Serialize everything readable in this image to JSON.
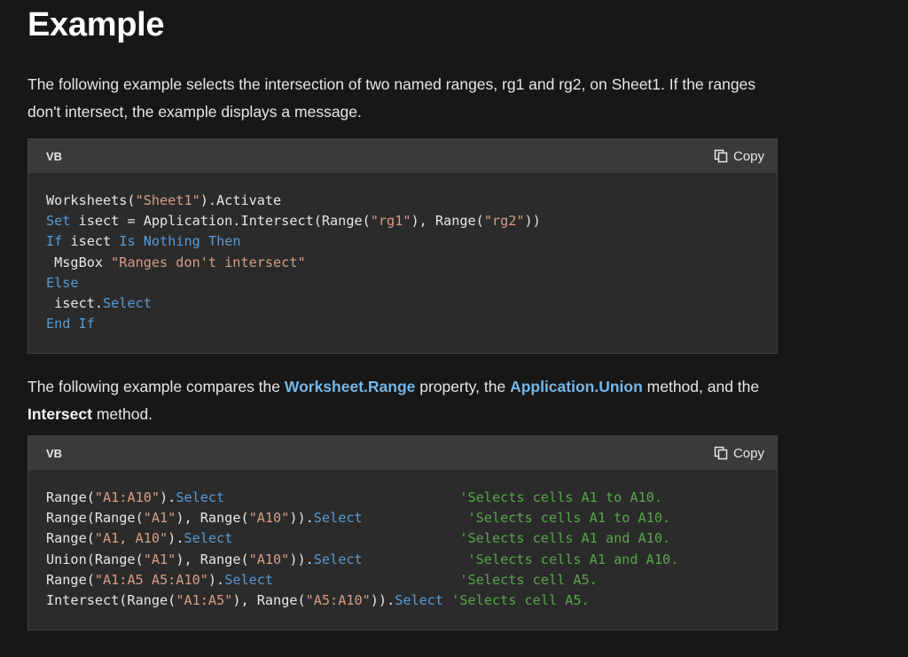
{
  "heading": "Example",
  "intro": "The following example selects the intersection of two named ranges, rg1 and rg2, on Sheet1. If the ranges don't intersect, the example displays a message.",
  "code1": {
    "language": "VB",
    "copy_label": "Copy",
    "lines": [
      [
        {
          "t": "Worksheets(",
          "c": "p"
        },
        {
          "t": "\"Sheet1\"",
          "c": "str"
        },
        {
          "t": ").Activate",
          "c": "p"
        }
      ],
      [
        {
          "t": "Set",
          "c": "kw"
        },
        {
          "t": " isect = Application.Intersect(Range(",
          "c": "p"
        },
        {
          "t": "\"rg1\"",
          "c": "str"
        },
        {
          "t": "), Range(",
          "c": "p"
        },
        {
          "t": "\"rg2\"",
          "c": "str"
        },
        {
          "t": "))",
          "c": "p"
        }
      ],
      [
        {
          "t": "If",
          "c": "kw"
        },
        {
          "t": " isect ",
          "c": "p"
        },
        {
          "t": "Is",
          "c": "kw"
        },
        {
          "t": " ",
          "c": "p"
        },
        {
          "t": "Nothing",
          "c": "kw"
        },
        {
          "t": " ",
          "c": "p"
        },
        {
          "t": "Then",
          "c": "kw"
        }
      ],
      [
        {
          "t": " MsgBox ",
          "c": "p"
        },
        {
          "t": "\"Ranges don't intersect\"",
          "c": "str"
        }
      ],
      [
        {
          "t": "Else",
          "c": "kw"
        }
      ],
      [
        {
          "t": " isect.",
          "c": "p"
        },
        {
          "t": "Select",
          "c": "kw"
        }
      ],
      [
        {
          "t": "End",
          "c": "kw"
        },
        {
          "t": " ",
          "c": "p"
        },
        {
          "t": "If",
          "c": "kw"
        }
      ]
    ]
  },
  "para2": {
    "prefix": "The following example compares the ",
    "link1": "Worksheet.Range",
    "mid1": " property, the ",
    "link2": "Application.Union",
    "mid2": " method, and the ",
    "bold": "Intersect",
    "suffix": " method."
  },
  "code2": {
    "language": "VB",
    "copy_label": "Copy",
    "lines": [
      [
        {
          "t": "Range(",
          "c": "p"
        },
        {
          "t": "\"A1:A10\"",
          "c": "str"
        },
        {
          "t": ").",
          "c": "p"
        },
        {
          "t": "Select",
          "c": "kw"
        },
        {
          "t": "                             ",
          "c": "p"
        },
        {
          "t": "'Selects cells A1 to A10.",
          "c": "cm"
        }
      ],
      [
        {
          "t": "Range(Range(",
          "c": "p"
        },
        {
          "t": "\"A1\"",
          "c": "str"
        },
        {
          "t": "), Range(",
          "c": "p"
        },
        {
          "t": "\"A10\"",
          "c": "str"
        },
        {
          "t": ")).",
          "c": "p"
        },
        {
          "t": "Select",
          "c": "kw"
        },
        {
          "t": "             ",
          "c": "p"
        },
        {
          "t": "'Selects cells A1 to A10.",
          "c": "cm"
        }
      ],
      [
        {
          "t": "Range(",
          "c": "p"
        },
        {
          "t": "\"A1, A10\"",
          "c": "str"
        },
        {
          "t": ").",
          "c": "p"
        },
        {
          "t": "Select",
          "c": "kw"
        },
        {
          "t": "                            ",
          "c": "p"
        },
        {
          "t": "'Selects cells A1 and A10.",
          "c": "cm"
        }
      ],
      [
        {
          "t": "Union(Range(",
          "c": "p"
        },
        {
          "t": "\"A1\"",
          "c": "str"
        },
        {
          "t": "), Range(",
          "c": "p"
        },
        {
          "t": "\"A10\"",
          "c": "str"
        },
        {
          "t": ")).",
          "c": "p"
        },
        {
          "t": "Select",
          "c": "kw"
        },
        {
          "t": "             ",
          "c": "p"
        },
        {
          "t": "'Selects cells A1 and A10.",
          "c": "cm"
        }
      ],
      [
        {
          "t": "Range(",
          "c": "p"
        },
        {
          "t": "\"A1:A5 A5:A10\"",
          "c": "str"
        },
        {
          "t": ").",
          "c": "p"
        },
        {
          "t": "Select",
          "c": "kw"
        },
        {
          "t": "                       ",
          "c": "p"
        },
        {
          "t": "'Selects cell A5.",
          "c": "cm"
        }
      ],
      [
        {
          "t": "Intersect(Range(",
          "c": "p"
        },
        {
          "t": "\"A1:A5\"",
          "c": "str"
        },
        {
          "t": "), Range(",
          "c": "p"
        },
        {
          "t": "\"A5:A10\"",
          "c": "str"
        },
        {
          "t": ")).",
          "c": "p"
        },
        {
          "t": "Select",
          "c": "kw"
        },
        {
          "t": " ",
          "c": "p"
        },
        {
          "t": "'Selects cell A5.",
          "c": "cm"
        }
      ]
    ]
  },
  "colors": {
    "background": "#171717",
    "code_background": "#2b2b2b",
    "code_header": "#3a3a3a",
    "link": "#75b6e7",
    "keyword": "#569cd6",
    "string": "#d69d85",
    "comment": "#57a64a"
  },
  "icons": {
    "copy": "copy-icon"
  }
}
